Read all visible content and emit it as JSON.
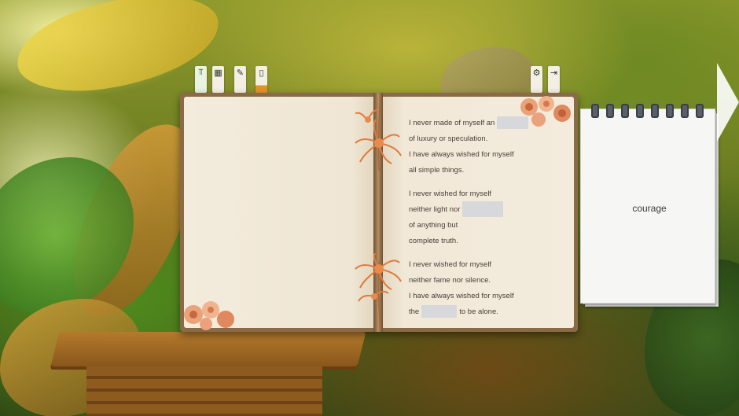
{
  "toolbar": {
    "left_tabs": [
      {
        "icon": "cross-icon",
        "glyph": "⫪"
      },
      {
        "icon": "book-icon",
        "glyph": "▦"
      },
      {
        "icon": "pencil-icon",
        "glyph": "✎"
      },
      {
        "icon": "note-icon",
        "glyph": "▯"
      }
    ],
    "right_tabs": [
      {
        "icon": "gear-icon",
        "glyph": "⚙"
      },
      {
        "icon": "exit-door-icon",
        "glyph": "⇥"
      }
    ]
  },
  "poem": {
    "stanza1": {
      "l1": "I never made of myself an",
      "l2": "of luxury or speculation.",
      "l3": "I have always wished for myself",
      "l4": "all simple things."
    },
    "stanza2": {
      "l1": "I never wished for myself",
      "l2": "neither light nor",
      "l3": "of anything but",
      "l4": "complete truth."
    },
    "stanza3": {
      "l1": "I never wished for myself",
      "l2": "neither fame nor silence.",
      "l3": "I have always wished for myself",
      "l4a": "the",
      "l4b": "to be alone."
    }
  },
  "notepad": {
    "word": "courage"
  },
  "colors": {
    "page": "#f1e8d8",
    "blank": "#d7d8dc",
    "tab_accent": "#e3922a",
    "flower": "#e07a3c"
  }
}
